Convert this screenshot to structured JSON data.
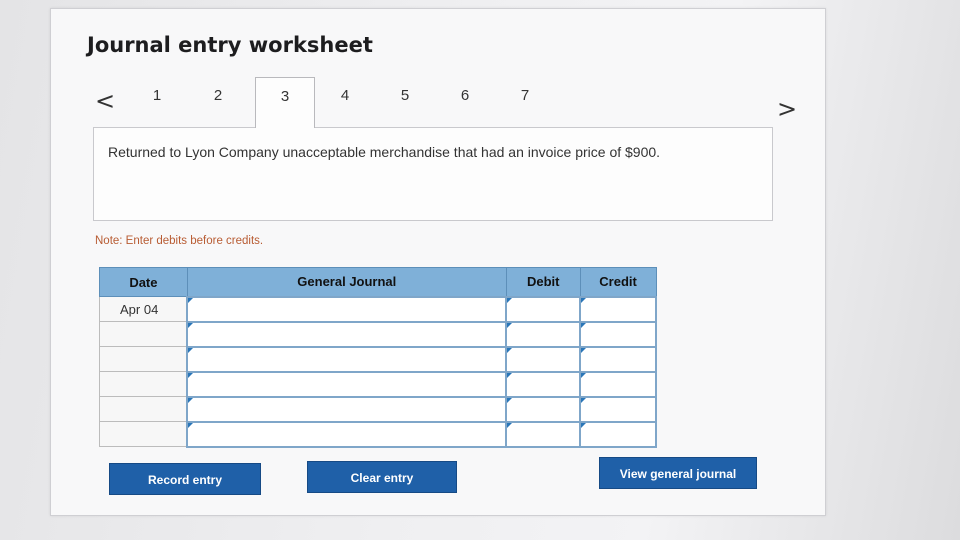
{
  "title": "Journal entry worksheet",
  "tabs": [
    "1",
    "2",
    "3",
    "4",
    "5",
    "6",
    "7"
  ],
  "active_tab": "3",
  "nav": {
    "prev": "<",
    "next": ">"
  },
  "prompt": "Returned to Lyon Company unacceptable merchandise that had an invoice price of $900.",
  "note": "Note: Enter debits before credits.",
  "journal": {
    "headers": {
      "date": "Date",
      "account": "General Journal",
      "debit": "Debit",
      "credit": "Credit"
    },
    "rows": [
      {
        "date": "Apr 04",
        "account": "",
        "debit": "",
        "credit": ""
      },
      {
        "date": "",
        "account": "",
        "debit": "",
        "credit": ""
      },
      {
        "date": "",
        "account": "",
        "debit": "",
        "credit": ""
      },
      {
        "date": "",
        "account": "",
        "debit": "",
        "credit": ""
      },
      {
        "date": "",
        "account": "",
        "debit": "",
        "credit": ""
      },
      {
        "date": "",
        "account": "",
        "debit": "",
        "credit": ""
      }
    ]
  },
  "buttons": {
    "record": "Record entry",
    "clear": "Clear entry",
    "view": "View general journal"
  }
}
